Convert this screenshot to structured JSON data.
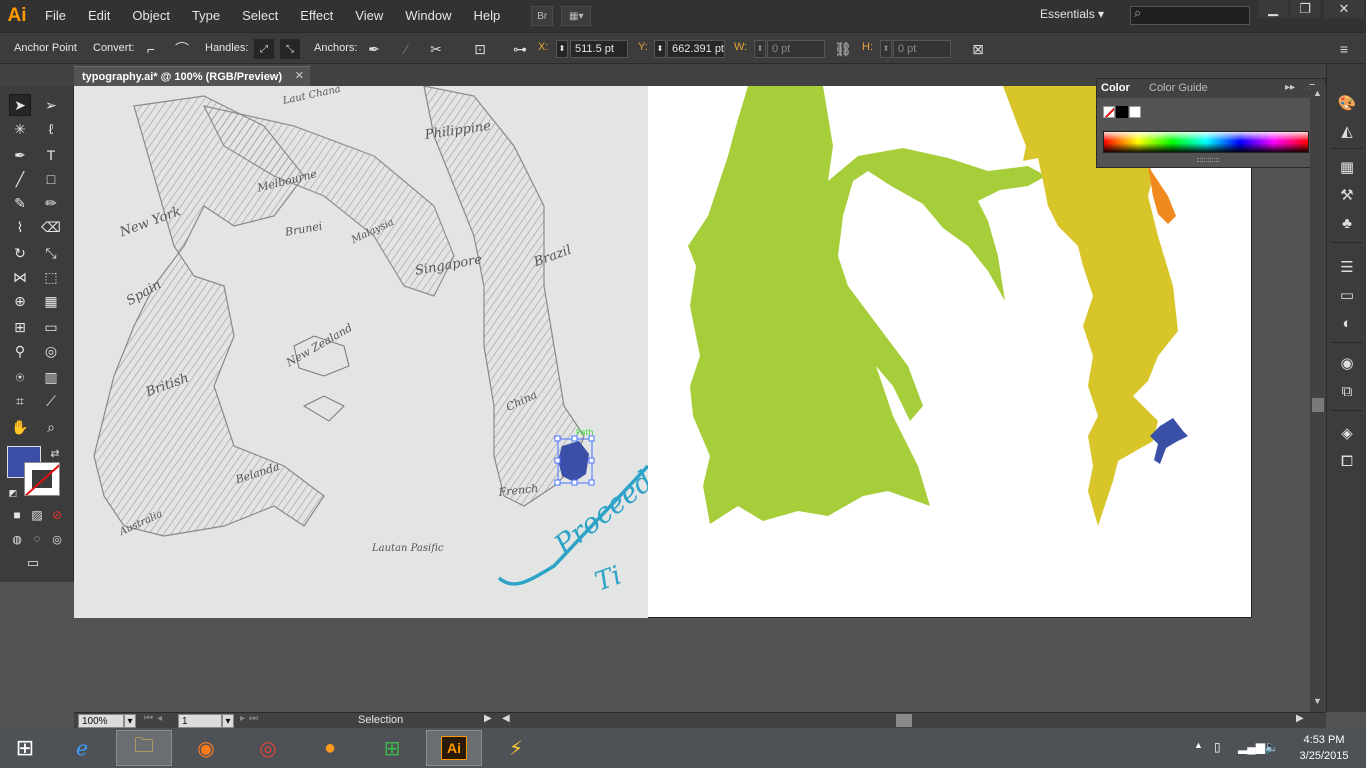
{
  "app": {
    "logo": "Ai",
    "menu": [
      "File",
      "Edit",
      "Object",
      "Type",
      "Select",
      "Effect",
      "View",
      "Window",
      "Help"
    ],
    "bridge_label": "Br",
    "workspace": "Essentials"
  },
  "controlbar": {
    "tool_name": "Anchor Point",
    "convert_label": "Convert:",
    "handles_label": "Handles:",
    "anchors_label": "Anchors:",
    "x_label": "X:",
    "x_value": "511.5 pt",
    "y_label": "Y:",
    "y_value": "662.391 pt",
    "w_label": "W:",
    "w_value": "0 pt",
    "h_label": "H:",
    "h_value": "0 pt"
  },
  "document": {
    "tab_title": "typography.ai* @ 100% (RGB/Preview)",
    "close_glyph": "✕"
  },
  "sketch_labels": {
    "l1": "Laut Chana",
    "l2": "Philippine",
    "l3": "New York",
    "l4": "Melbourne",
    "l5": "Brunei",
    "l6": "Malaysia",
    "l7": "Singapore",
    "l8": "Brazil",
    "l9": "Spain",
    "l10": "New Zealand",
    "l11": "British",
    "l12": "China",
    "l13": "Path",
    "l14": "Belanda",
    "l15": "French",
    "l16": "Australia",
    "l17": "Lautan Pasific",
    "l18": "Proceed",
    "l19": "Ti"
  },
  "color_panel": {
    "tab_color": "Color",
    "tab_guide": "Color Guide"
  },
  "colors": {
    "fill": "#3b4fa8",
    "green_shape": "#a6ce3a",
    "yellow_shape": "#d8c52a",
    "orange_shape": "#f08a1e",
    "blue_shape": "#3a4fa6"
  },
  "statusbar": {
    "zoom": "100%",
    "page": "1",
    "mode": "Selection"
  },
  "taskbar": {
    "time": "4:53 PM",
    "date": "3/25/2015",
    "ai_label": "Ai"
  }
}
